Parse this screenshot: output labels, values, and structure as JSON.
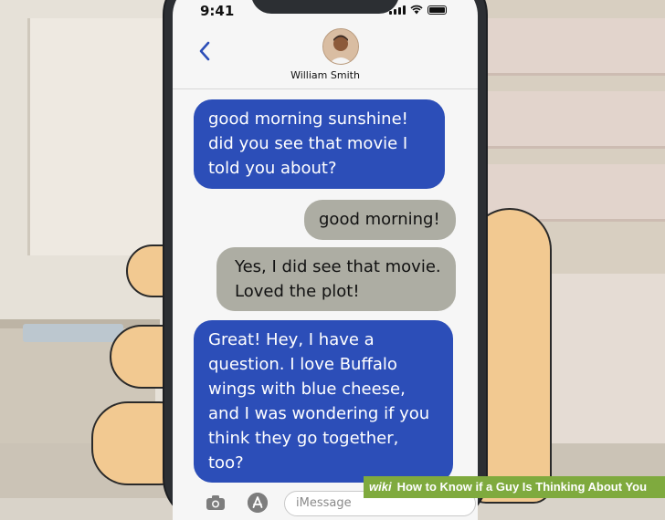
{
  "status_bar": {
    "time": "9:41"
  },
  "header": {
    "back_icon": "chevron-left-icon",
    "contact_name": "William Smith"
  },
  "messages": [
    {
      "side": "left",
      "style": "blue",
      "text": "good morning sunshine! did you see that movie I told you about?"
    },
    {
      "side": "right",
      "style": "gray",
      "text": "good morning!"
    },
    {
      "side": "right",
      "style": "gray",
      "text": "Yes, I did see that movie. Loved the plot!"
    },
    {
      "side": "left",
      "style": "blue",
      "text": "Great! Hey, I have a question. I love Buffalo wings with blue cheese, and I was wondering if you think they go together, too?"
    }
  ],
  "input_bar": {
    "placeholder": "iMessage",
    "icons": [
      "camera-icon",
      "app-store-icon"
    ]
  },
  "watermark": {
    "brand": "wiki",
    "title": "How to Know if a Guy Is Thinking About You"
  },
  "colors": {
    "sent_bubble": "#2c4eb8",
    "received_bubble": "#adada3",
    "skin": "#f2c991",
    "watermark_green": "#7faa3e"
  }
}
